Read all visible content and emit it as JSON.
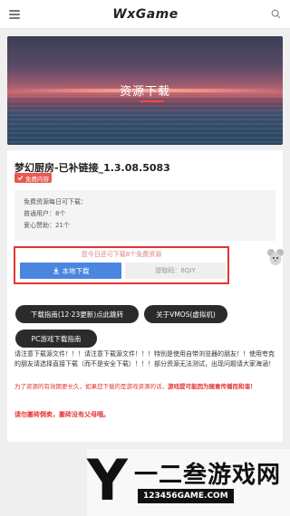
{
  "header": {
    "logo": "WxGame"
  },
  "banner": {
    "title": "资源下载"
  },
  "game": {
    "title": "梦幻厨房-已补链接_1.3.08.5083",
    "badge": "免费内容"
  },
  "info": {
    "lines": [
      "免费资源每日可下载：",
      "普通用户：8个",
      "爱心赞助：21个"
    ]
  },
  "download": {
    "tip": "您今日还可下载8个免费资源",
    "button_label": "本地下载",
    "code_text": "提取码：8QIY"
  },
  "guides": {
    "guide_label": "下载指南(12·23更新)点此跳转",
    "vmos_label": "关于VMOS(虚拟机)",
    "pc_label": "PC游戏下载指南"
  },
  "notes": {
    "description": "请注意下载源文件！！！请注意下载源文件！！！特别是使用自带浏览器的朋友！！使用夸克的朋友请选择直接下载（而不是安全下载）！！！部分资源无法测试，出现问题请大家海涵！",
    "warning_plain": "为了资源的有效期更长久，如果您下载的是游戏资源的话，",
    "warning_bold": "游戏提可能因为随意传播而和谐！",
    "warning_final": "请勿搬砖倒卖，搬砖没有父母哦。"
  },
  "watermark": {
    "brand_letter": "Y",
    "brand_cn": "一二叁游戏网",
    "url": "123456GAME.COM"
  },
  "colors": {
    "accent_blue": "#4a86e0",
    "warning_red": "#e53333",
    "badge_red": "#e85a4f",
    "pill_dark": "#2b2b2b"
  }
}
